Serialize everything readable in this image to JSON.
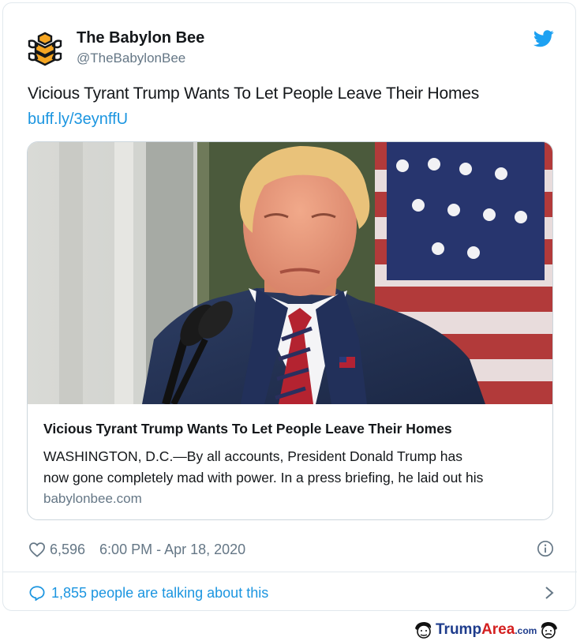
{
  "tweet": {
    "author_name": "The Babylon Bee",
    "author_handle": "@TheBabylonBee",
    "text": "Vicious Tyrant Trump Wants To Let People Leave Their Homes",
    "link": "buff.ly/3eynffU",
    "likes": "6,596",
    "timestamp": "6:00 PM - Apr 18, 2020",
    "talking": "1,855 people are talking about this"
  },
  "card": {
    "title": "Vicious Tyrant Trump Wants To Let People Leave Their Homes",
    "description_line1": "WASHINGTON, D.C.—By all accounts, President Donald Trump has",
    "description_line2": "now gone completely mad with power. In a press briefing, he laid out his",
    "domain": "babylonbee.com"
  },
  "watermark": {
    "brand_part1": "Trump",
    "brand_part2": "Area",
    "brand_tld": ".com"
  },
  "colors": {
    "link_blue": "#1b95e0",
    "muted_gray": "#657786",
    "border": "#e1e8ed",
    "bee_orange": "#f5a623"
  },
  "icons": {
    "avatar": "babylon-bee-logo",
    "brand": "twitter-bird-icon",
    "like": "heart-icon",
    "info": "info-icon",
    "reply": "speech-bubble-icon",
    "more": "chevron-right-icon"
  }
}
